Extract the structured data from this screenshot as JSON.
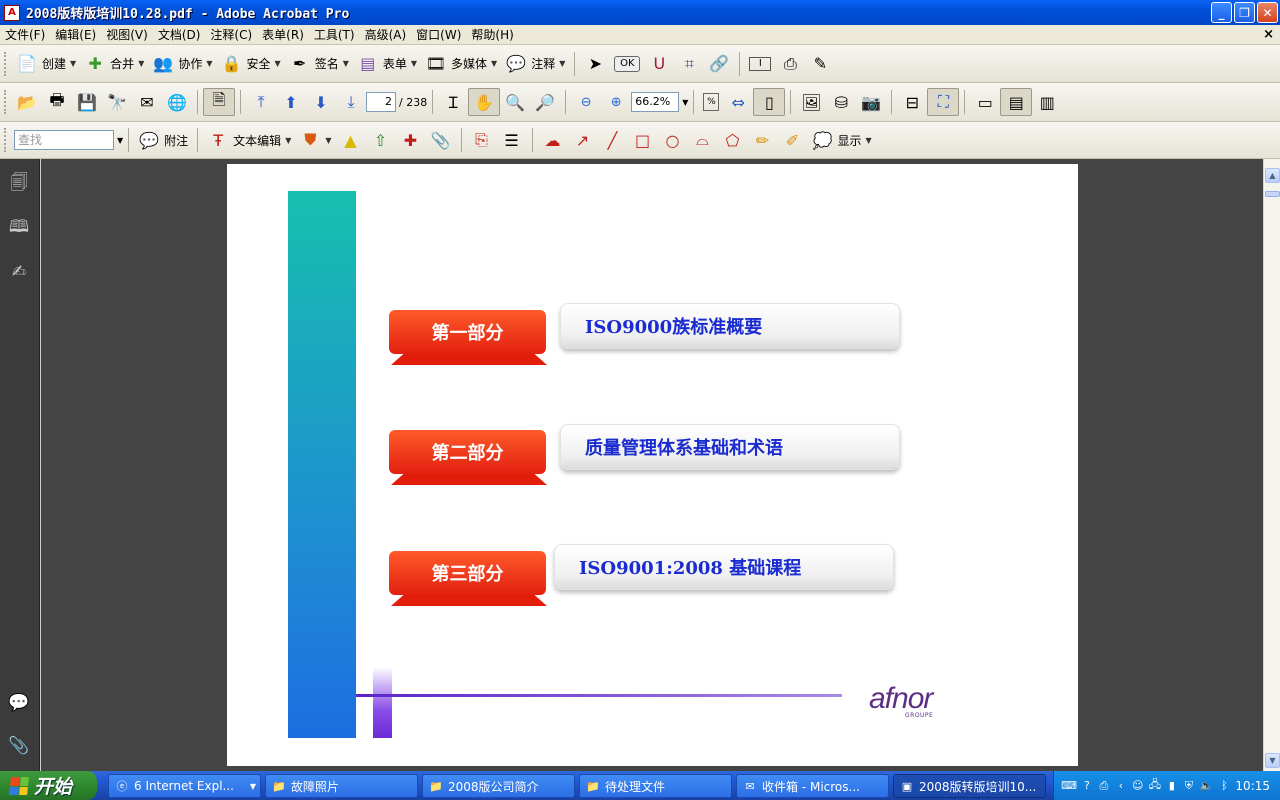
{
  "window": {
    "title": "2008版转版培训10.28.pdf - Adobe Acrobat Pro",
    "app_icon": "acrobat-icon"
  },
  "menu": [
    "文件(F)",
    "编辑(E)",
    "视图(V)",
    "文档(D)",
    "注释(C)",
    "表单(R)",
    "工具(T)",
    "高级(A)",
    "窗口(W)",
    "帮助(H)"
  ],
  "toolbar1": {
    "create": "创建",
    "combine": "合并",
    "collaborate": "协作",
    "secure": "安全",
    "sign": "签名",
    "forms": "表单",
    "multimedia": "多媒体",
    "comment": "注释",
    "ok_label": "OK"
  },
  "toolbar2": {
    "page_current": "2",
    "page_total": "/ 238",
    "zoom": "66.2%"
  },
  "toolbar3": {
    "search_placeholder": "查找",
    "sticky_note": "附注",
    "text_edit": "文本编辑",
    "show": "显示"
  },
  "slide": {
    "sections": [
      {
        "tag": "第一部分",
        "title": "ISO9000族标准概要"
      },
      {
        "tag": "第二部分",
        "title": "质量管理体系基础和术语"
      },
      {
        "tag": "第三部分",
        "title": "ISO9001:2008 基础课程"
      }
    ],
    "logo_word": "afnor",
    "logo_sub": "GROUPE",
    "colors": {
      "ribbon": "#e22010",
      "title_text": "#1a2bd0",
      "sidebar_gradient_top": "#17bfae",
      "sidebar_gradient_bottom": "#1b6de0",
      "logo": "#5b2f86"
    }
  },
  "taskbar": {
    "start": "开始",
    "tasks": [
      {
        "label": "6 Internet Expl...",
        "icon": "ie-icon"
      },
      {
        "label": "故障照片",
        "icon": "folder-icon"
      },
      {
        "label": "2008版公司简介",
        "icon": "folder-icon"
      },
      {
        "label": "待处理文件",
        "icon": "folder-icon"
      },
      {
        "label": "收件箱 - Micros...",
        "icon": "outlook-icon"
      },
      {
        "label": "2008版转版培训10...",
        "icon": "acrobat-icon"
      }
    ],
    "clock": "10:15"
  }
}
